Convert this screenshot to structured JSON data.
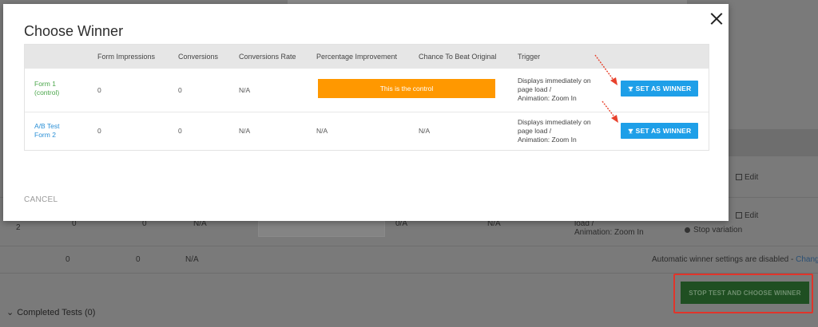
{
  "background": {
    "rows": [
      {
        "name": "2",
        "impressions": "0",
        "conversions": "0",
        "rate": "N/A",
        "improvement": "0/A",
        "chance": "N/A",
        "trigger_line1": "load /",
        "trigger_line2": "Animation: Zoom In"
      },
      {
        "name": "",
        "impressions": "0",
        "conversions": "0",
        "rate": "N/A"
      }
    ],
    "edit_label": "Edit",
    "stop_variation_label": "Stop variation",
    "auto_winner_text": "Automatic winner settings are disabled -",
    "change_link": "Change",
    "stop_test_button": "STOP TEST AND CHOOSE WINNER",
    "completed_tests": "Completed Tests (0)"
  },
  "modal": {
    "title": "Choose Winner",
    "columns": [
      "Form Impressions",
      "Conversions",
      "Conversions Rate",
      "Percentage Improvement",
      "Chance To Beat Original",
      "Trigger"
    ],
    "rows": [
      {
        "form_name_line1": "Form 1",
        "form_name_line2": "(control)",
        "impressions": "0",
        "conversions": "0",
        "rate": "N/A",
        "control_label": "This is the control",
        "trigger_line1": "Displays immediately on",
        "trigger_line2": "page load /",
        "trigger_line3": "Animation: Zoom In",
        "button": "SET AS WINNER"
      },
      {
        "form_name_line1": "A/B Test",
        "form_name_line2": "Form 2",
        "impressions": "0",
        "conversions": "0",
        "rate": "N/A",
        "improvement": "N/A",
        "chance": "N/A",
        "trigger_line1": "Displays immediately on",
        "trigger_line2": "page load /",
        "trigger_line3": "Animation: Zoom In",
        "button": "SET AS WINNER"
      }
    ],
    "cancel": "CANCEL"
  },
  "colors": {
    "control_bar": "#ff9800",
    "winner_button": "#1e9fe8",
    "form1_link": "#4aa64a",
    "form2_link": "#2a8fd6",
    "annotation_arrow": "#e8412c",
    "highlight_frame": "#e0352b"
  },
  "icons": [
    "close-icon",
    "trophy-icon",
    "edit-icon",
    "stop-icon",
    "chevron-down-icon",
    "annotation-arrow"
  ]
}
